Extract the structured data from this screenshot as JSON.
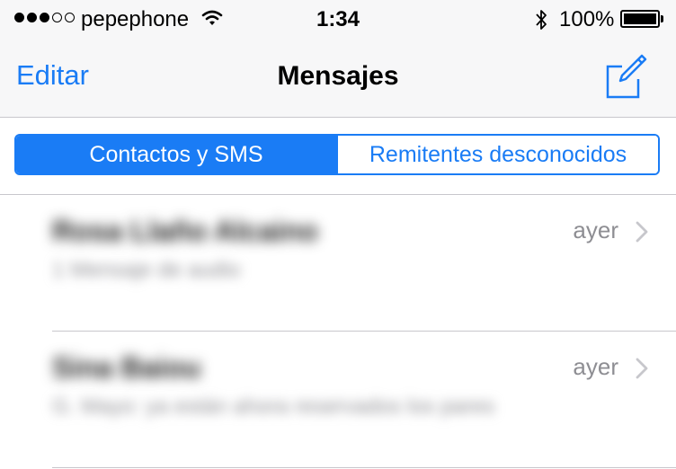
{
  "status_bar": {
    "signal_strength": "3 of 5",
    "carrier": "pepephone",
    "time": "1:34",
    "battery_percent": "100%",
    "icons": [
      "wifi-icon",
      "bluetooth-icon",
      "battery-icon"
    ]
  },
  "nav_bar": {
    "edit_label": "Editar",
    "title": "Mensajes",
    "compose_icon": "compose-icon"
  },
  "segmented": {
    "options": [
      "Contactos y SMS",
      "Remitentes desconocidos"
    ],
    "selected": "Contactos y SMS"
  },
  "messages": [
    {
      "name": "Rosa Llaño Alcaino",
      "preview": "1 Mensaje de audio",
      "date": "ayer"
    },
    {
      "name": "Sina Baiou",
      "preview": "G. Mayo: ya están ahora reservados los pares",
      "date": "ayer"
    }
  ],
  "colors": {
    "accent": "#1a7cf5",
    "bar_background": "#f7f7f8",
    "secondary_text": "#8e8e93",
    "separator": "#c8c7cc"
  }
}
